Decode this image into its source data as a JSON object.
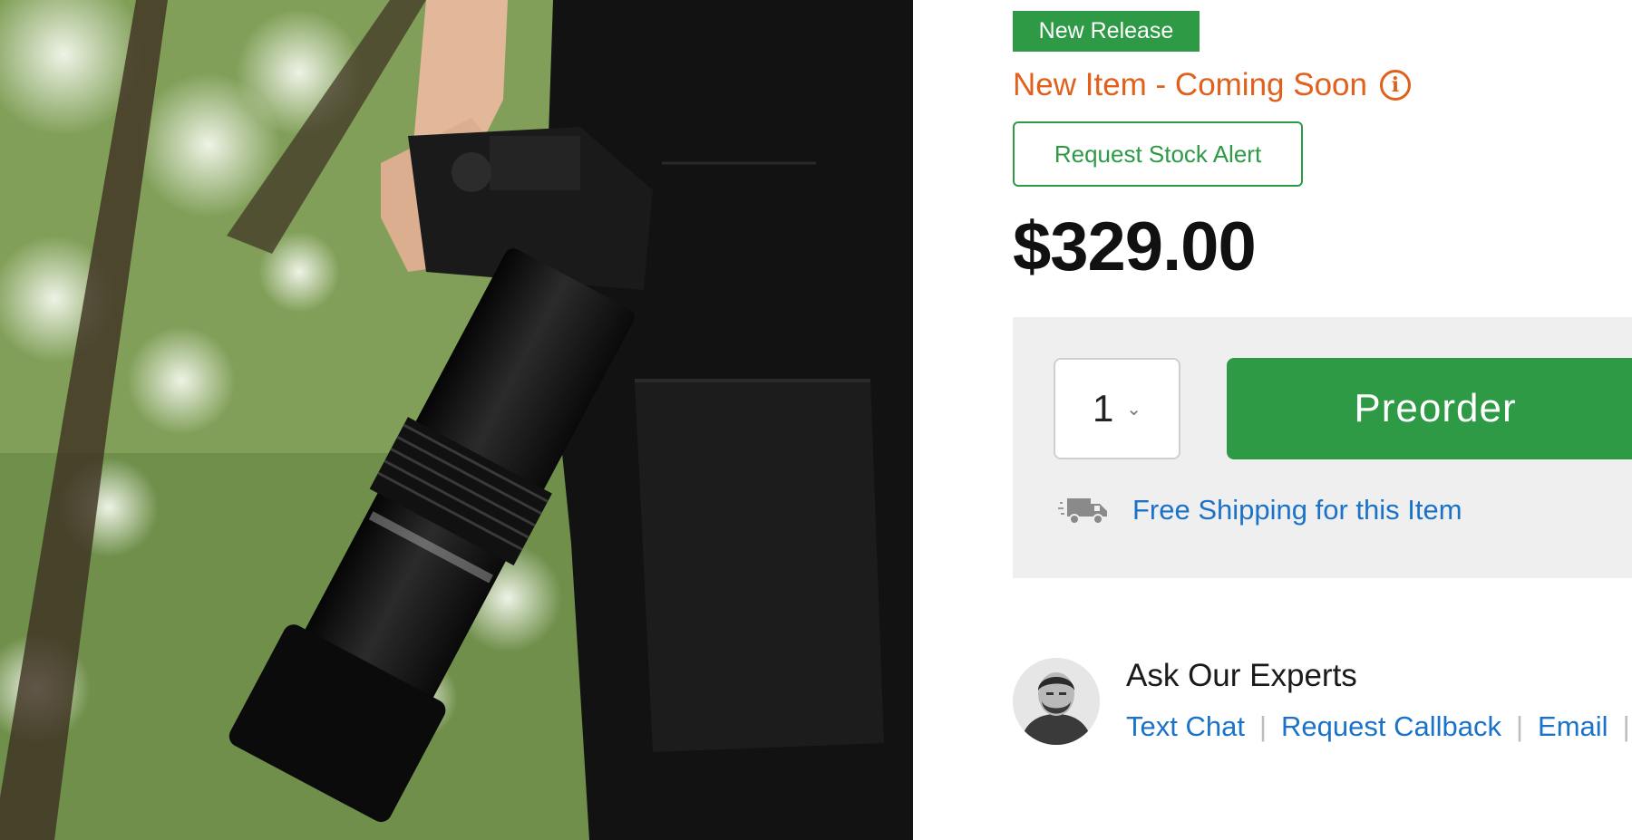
{
  "product": {
    "badge": "New Release",
    "status": "New Item - Coming Soon",
    "stock_alert_label": "Request Stock Alert",
    "price": "$329.00"
  },
  "purchase": {
    "quantity": "1",
    "preorder_label": "Preorder",
    "shipping_text": "Free Shipping for this Item"
  },
  "experts": {
    "title": "Ask Our Experts",
    "links": {
      "text_chat": "Text Chat",
      "callback": "Request Callback",
      "email": "Email"
    },
    "separator": "|"
  },
  "icons": {
    "status": "info-icon",
    "quantity": "chevron-down-icon",
    "shipping": "truck-icon"
  },
  "colors": {
    "accent_green": "#2e9a46",
    "status_orange": "#e0601c",
    "link_blue": "#1a73c8"
  }
}
